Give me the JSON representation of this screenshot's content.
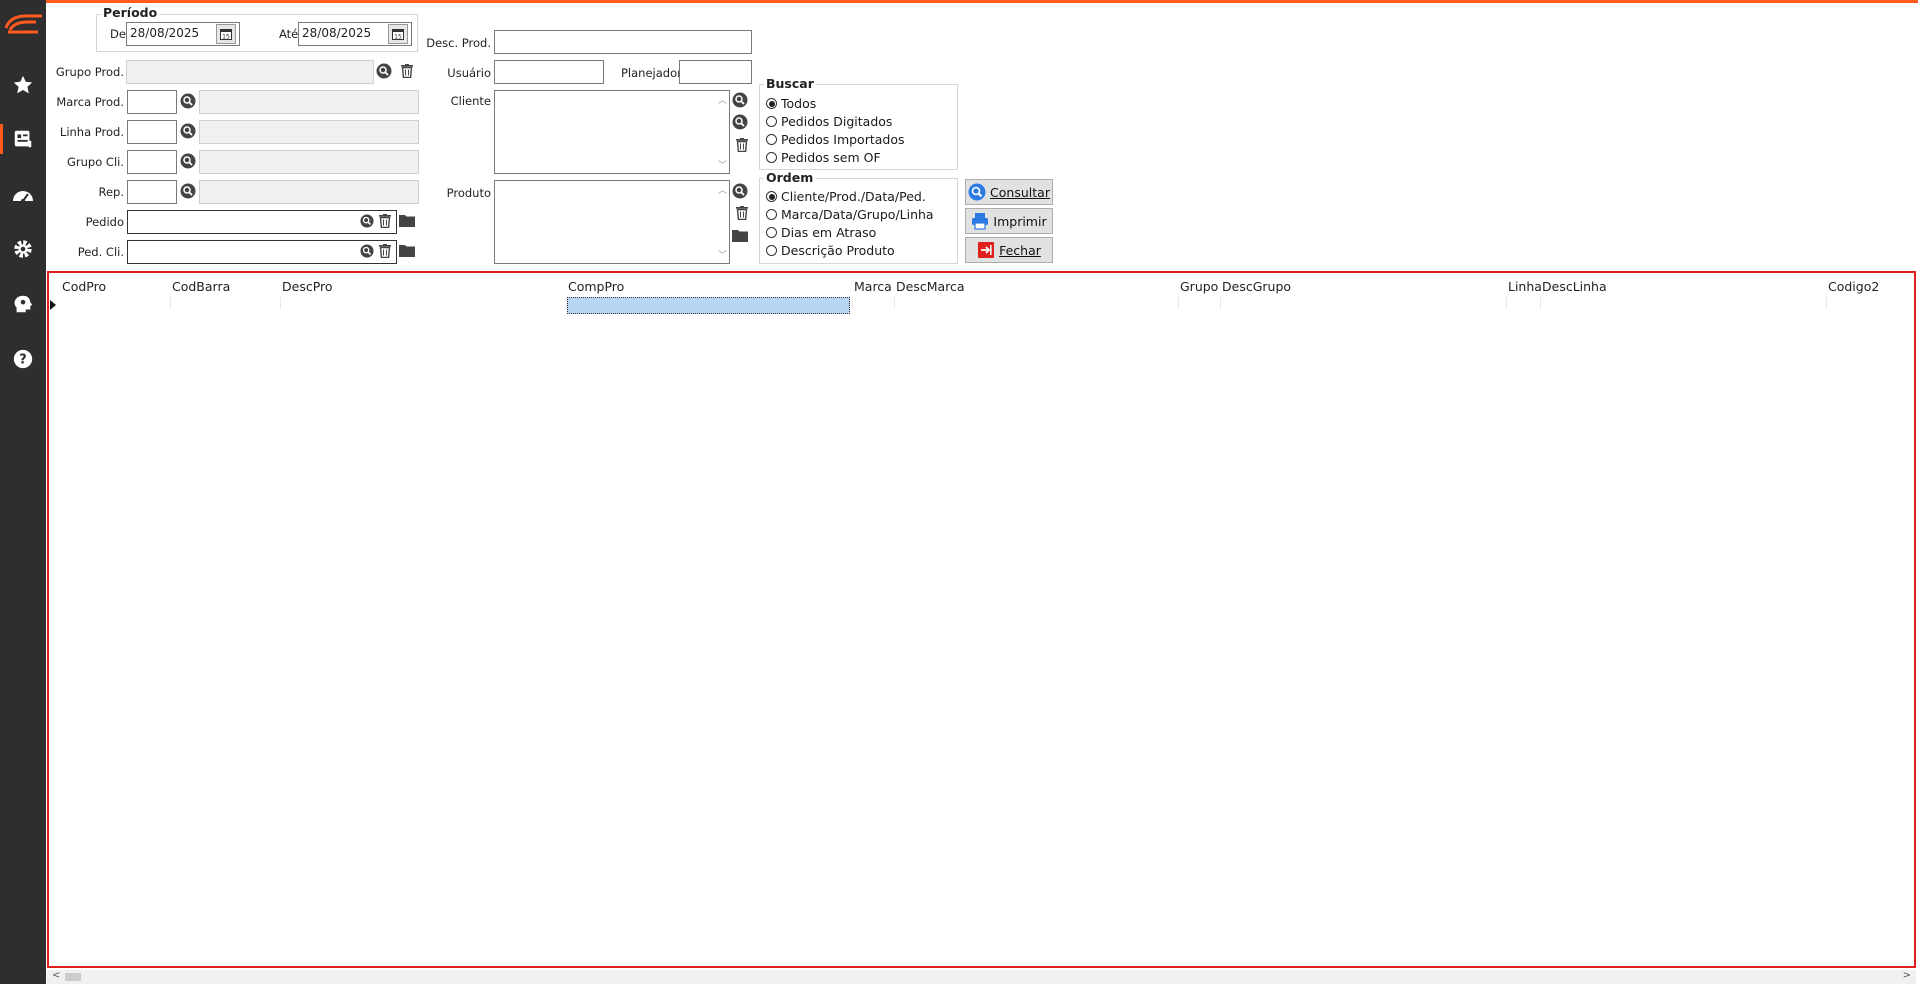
{
  "filters": {
    "periodo_title": "Período",
    "de_label": "De",
    "de_value": "28/08/2025",
    "ate_label": "Até",
    "ate_value": "28/08/2025",
    "grupo_prod_label": "Grupo Prod.",
    "marca_prod_label": "Marca Prod.",
    "linha_prod_label": "Linha Prod.",
    "grupo_cli_label": "Grupo Cli.",
    "rep_label": "Rep.",
    "pedido_label": "Pedido",
    "ped_cli_label": "Ped. Cli.",
    "desc_prod_label": "Desc. Prod.",
    "usuario_label": "Usuário",
    "planejador_label": "Planejador",
    "cliente_label": "Cliente",
    "produto_label": "Produto"
  },
  "buscar": {
    "title": "Buscar",
    "options": [
      "Todos",
      "Pedidos Digitados",
      "Pedidos Importados",
      "Pedidos sem OF"
    ],
    "selected": 0
  },
  "ordem": {
    "title": "Ordem",
    "options": [
      "Cliente/Prod./Data/Ped.",
      "Marca/Data/Grupo/Linha",
      "Dias em Atraso",
      "Descrição Produto"
    ],
    "selected": 0
  },
  "buttons": {
    "consultar_label": "Consultar",
    "imprimir_label": "Imprimir",
    "fechar_label": "Fechar"
  },
  "grid": {
    "columns": [
      "CodPro",
      "CodBarra",
      "DescPro",
      "CompPro",
      "Marca",
      "DescMarca",
      "Grupo",
      "DescGrupo",
      "Linha",
      "DescLinha",
      "Codigo2"
    ]
  },
  "colors": {
    "accent": "#ff5a1f",
    "sidebar": "#2e2e2e",
    "grid_border": "#e0201c",
    "selection": "#b7d4f2"
  }
}
